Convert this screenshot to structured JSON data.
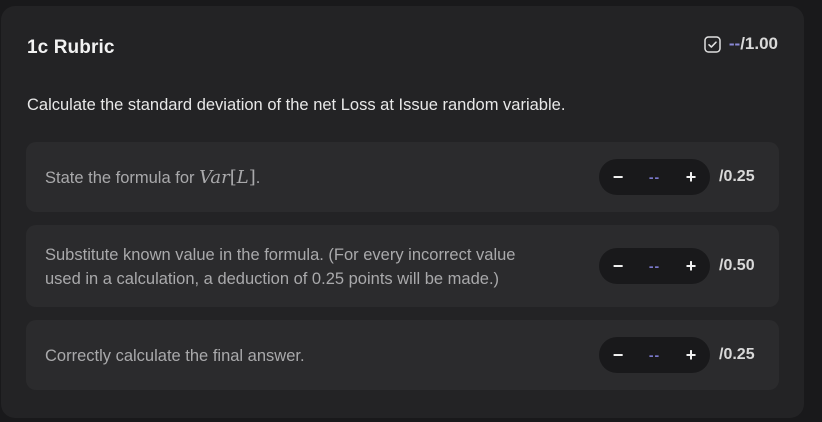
{
  "rubric": {
    "title": "1c Rubric",
    "total": {
      "value": "--",
      "max": "/1.00"
    },
    "question": "Calculate the standard deviation of the net Loss at Issue random variable."
  },
  "criteria": [
    {
      "text_prefix": "State the formula for ",
      "math": {
        "name": "Var",
        "open": "[",
        "arg": "L",
        "close": "]"
      },
      "text_suffix": ".",
      "decrement_label": "−",
      "value": "--",
      "increment_label": "+",
      "max": "/0.25"
    },
    {
      "line1": "Substitute known value in the formula. (For every incorrect value",
      "line2": "used in a calculation, a deduction of 0.25 points will be made.)",
      "decrement_label": "−",
      "value": "--",
      "increment_label": "+",
      "max": "/0.50"
    },
    {
      "text": "Correctly calculate the final answer.",
      "decrement_label": "−",
      "value": "--",
      "increment_label": "+",
      "max": "/0.25"
    }
  ],
  "colors": {
    "background": "#19191b",
    "card": "#232325",
    "criterion_row": "#2b2b2d",
    "accent": "#7b79cc"
  }
}
